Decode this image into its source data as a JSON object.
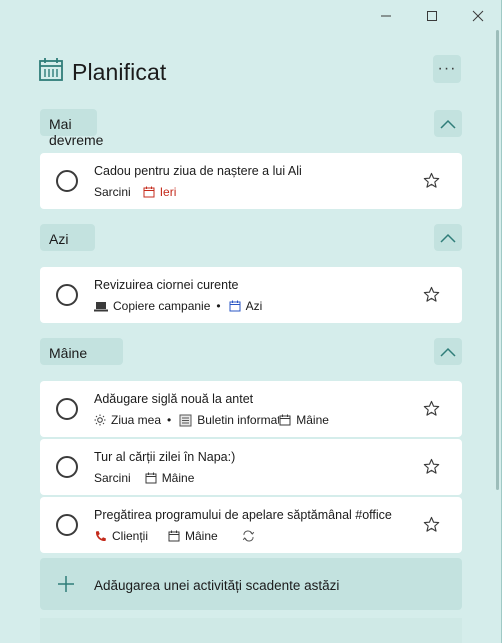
{
  "window": {
    "minimize_icon": "minimize-icon",
    "maximize_icon": "maximize-icon",
    "close_icon": "close-icon"
  },
  "header": {
    "title": "Planificat",
    "more_label": "···"
  },
  "groups": [
    {
      "label": "Mai devreme",
      "tasks": [
        {
          "title": "Cadou pentru ziua de naștere a lui Ali",
          "list": "Sarcini",
          "due": "Ieri"
        }
      ]
    },
    {
      "label": "Azi",
      "tasks": [
        {
          "title": "Revizuirea ciornei curente",
          "list": "Copiere campanie",
          "due": "Azi"
        }
      ]
    },
    {
      "label": "Mâine",
      "tasks": [
        {
          "title": "Adăugare siglă nouă la antet",
          "myday": "Ziua mea",
          "list": "Buletin informativ",
          "due": "Mâine"
        },
        {
          "title": "Tur al cărții zilei în Napa:)",
          "list": "Sarcini",
          "due": "Mâine"
        },
        {
          "title": "Pregătirea programului de apelare săptămânal #office",
          "list": "Clienții",
          "due": "Mâine"
        }
      ]
    }
  ],
  "add_task": {
    "label": "Adăugarea unei activități scadente astăzi"
  },
  "colors": {
    "background": "#d5edeb",
    "accent": "#2f7d79",
    "overdue": "#c42b1c",
    "due_today": "#2b57c4"
  }
}
